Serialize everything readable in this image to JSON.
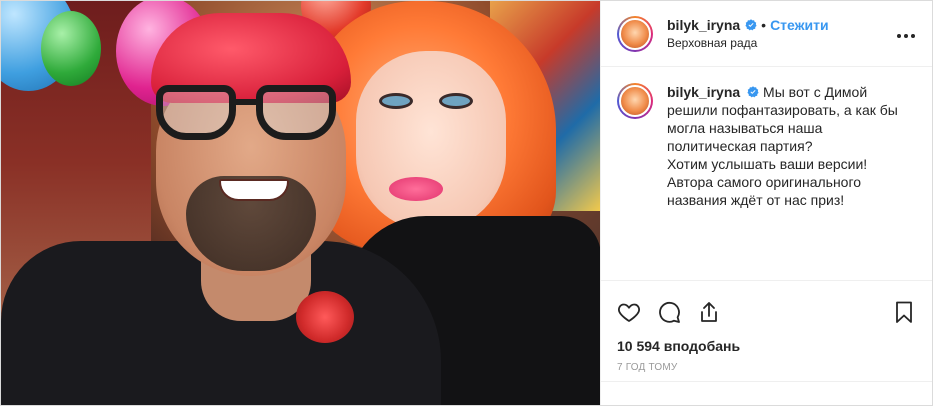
{
  "post": {
    "username": "bilyk_iryna",
    "separator": "•",
    "follow_label": "Стежити",
    "location": "Верховная рада",
    "more_icon": "more-horizontal-icon",
    "caption": {
      "username": "bilyk_iryna",
      "lines": [
        "Мы вот с Димой",
        "решили пофантазировать, а как бы",
        "могла называться наша",
        "политическая партия?",
        "Хотим услышать ваши версии!",
        "Автора самого оригинального",
        "названия ждёт от нас приз!"
      ]
    },
    "likes_text": "10 594 вподобань",
    "time_text": "7 год тому"
  },
  "icons": {
    "like": "heart-icon",
    "comment": "comment-icon",
    "share": "share-icon",
    "save": "bookmark-icon",
    "verified": "verified-badge-icon"
  },
  "colors": {
    "link": "#3897f0",
    "text": "#262626",
    "muted": "#999999",
    "border": "#dbdbdb"
  }
}
